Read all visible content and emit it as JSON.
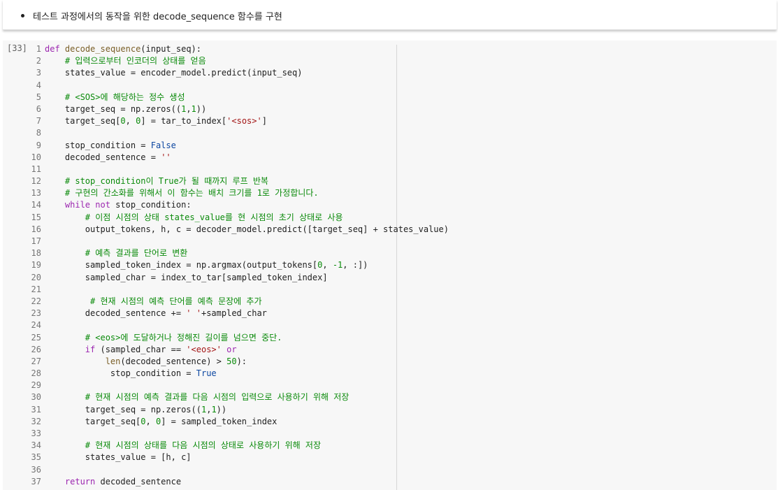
{
  "text_cell": {
    "bullet": "테스트 과정에서의 동작을 위한 decode_sequence 함수를 구현"
  },
  "code_cell": {
    "execution_count": "[33]",
    "lines": [
      {
        "n": "1",
        "indent": "",
        "tokens": [
          {
            "t": "def",
            "c": "kw"
          },
          {
            "t": " "
          },
          {
            "t": "decode_sequence",
            "c": "fn"
          },
          {
            "t": "(input_seq):"
          }
        ]
      },
      {
        "n": "2",
        "indent": "    ",
        "tokens": [
          {
            "t": "# 입력으로부터 인코더의 상태를 얻음",
            "c": "cm"
          }
        ]
      },
      {
        "n": "3",
        "indent": "    ",
        "tokens": [
          {
            "t": "states_value = encoder_model.predict(input_seq)"
          }
        ]
      },
      {
        "n": "4",
        "indent": "",
        "tokens": []
      },
      {
        "n": "5",
        "indent": "    ",
        "tokens": [
          {
            "t": "# <SOS>에 해당하는 정수 생성",
            "c": "cm"
          }
        ]
      },
      {
        "n": "6",
        "indent": "    ",
        "tokens": [
          {
            "t": "target_seq = np.zeros(("
          },
          {
            "t": "1",
            "c": "nm"
          },
          {
            "t": ","
          },
          {
            "t": "1",
            "c": "nm"
          },
          {
            "t": "))"
          }
        ]
      },
      {
        "n": "7",
        "indent": "    ",
        "tokens": [
          {
            "t": "target_seq["
          },
          {
            "t": "0",
            "c": "nm"
          },
          {
            "t": ", "
          },
          {
            "t": "0",
            "c": "nm"
          },
          {
            "t": "] = tar_to_index["
          },
          {
            "t": "'<sos>'",
            "c": "st"
          },
          {
            "t": "]"
          }
        ]
      },
      {
        "n": "8",
        "indent": "",
        "tokens": []
      },
      {
        "n": "9",
        "indent": "    ",
        "tokens": [
          {
            "t": "stop_condition = "
          },
          {
            "t": "False",
            "c": "kw2"
          }
        ]
      },
      {
        "n": "10",
        "indent": "    ",
        "tokens": [
          {
            "t": "decoded_sentence = "
          },
          {
            "t": "''",
            "c": "st"
          }
        ]
      },
      {
        "n": "11",
        "indent": "",
        "tokens": []
      },
      {
        "n": "12",
        "indent": "    ",
        "tokens": [
          {
            "t": "# stop_condition이 True가 될 때까지 루프 반복",
            "c": "cm"
          }
        ]
      },
      {
        "n": "13",
        "indent": "    ",
        "tokens": [
          {
            "t": "# 구현의 간소화를 위해서 이 함수는 배치 크기를 1로 가정합니다.",
            "c": "cm"
          }
        ]
      },
      {
        "n": "14",
        "indent": "    ",
        "tokens": [
          {
            "t": "while",
            "c": "kw"
          },
          {
            "t": " "
          },
          {
            "t": "not",
            "c": "kw"
          },
          {
            "t": " stop_condition:"
          }
        ]
      },
      {
        "n": "15",
        "indent": "        ",
        "tokens": [
          {
            "t": "# 이점 시점의 상태 states_value를 현 시점의 초기 상태로 사용",
            "c": "cm"
          }
        ]
      },
      {
        "n": "16",
        "indent": "        ",
        "tokens": [
          {
            "t": "output_tokens, h, c = decoder_model.predict([target_seq] + states_value)"
          }
        ]
      },
      {
        "n": "17",
        "indent": "",
        "tokens": []
      },
      {
        "n": "18",
        "indent": "        ",
        "tokens": [
          {
            "t": "# 예측 결과를 단어로 변환",
            "c": "cm"
          }
        ]
      },
      {
        "n": "19",
        "indent": "        ",
        "tokens": [
          {
            "t": "sampled_token_index = np.argmax(output_tokens["
          },
          {
            "t": "0",
            "c": "nm"
          },
          {
            "t": ", "
          },
          {
            "t": "-1",
            "c": "nm"
          },
          {
            "t": ", :])"
          }
        ]
      },
      {
        "n": "20",
        "indent": "        ",
        "tokens": [
          {
            "t": "sampled_char = index_to_tar[sampled_token_index]"
          }
        ]
      },
      {
        "n": "21",
        "indent": "",
        "tokens": []
      },
      {
        "n": "22",
        "indent": "         ",
        "tokens": [
          {
            "t": "# 현재 시점의 예측 단어를 예측 문장에 추가",
            "c": "cm"
          }
        ]
      },
      {
        "n": "23",
        "indent": "        ",
        "tokens": [
          {
            "t": "decoded_sentence += "
          },
          {
            "t": "' '",
            "c": "st"
          },
          {
            "t": "+sampled_char"
          }
        ]
      },
      {
        "n": "24",
        "indent": "",
        "tokens": []
      },
      {
        "n": "25",
        "indent": "        ",
        "tokens": [
          {
            "t": "# <eos>에 도달하거나 정해진 길이를 넘으면 중단.",
            "c": "cm"
          }
        ]
      },
      {
        "n": "26",
        "indent": "        ",
        "tokens": [
          {
            "t": "if",
            "c": "kw"
          },
          {
            "t": " (sampled_char == "
          },
          {
            "t": "'<eos>'",
            "c": "st"
          },
          {
            "t": " "
          },
          {
            "t": "or",
            "c": "kw"
          }
        ]
      },
      {
        "n": "27",
        "indent": "            ",
        "tokens": [
          {
            "t": "len",
            "c": "bi"
          },
          {
            "t": "(decoded_sentence) > "
          },
          {
            "t": "50",
            "c": "nm"
          },
          {
            "t": "):"
          }
        ]
      },
      {
        "n": "28",
        "indent": "             ",
        "tokens": [
          {
            "t": "stop_condition = "
          },
          {
            "t": "True",
            "c": "kw2"
          }
        ]
      },
      {
        "n": "29",
        "indent": "",
        "tokens": []
      },
      {
        "n": "30",
        "indent": "        ",
        "tokens": [
          {
            "t": "# 현재 시점의 예측 결과를 다음 시점의 입력으로 사용하기 위해 저장",
            "c": "cm"
          }
        ]
      },
      {
        "n": "31",
        "indent": "        ",
        "tokens": [
          {
            "t": "target_seq = np.zeros(("
          },
          {
            "t": "1",
            "c": "nm"
          },
          {
            "t": ","
          },
          {
            "t": "1",
            "c": "nm"
          },
          {
            "t": "))"
          }
        ]
      },
      {
        "n": "32",
        "indent": "        ",
        "tokens": [
          {
            "t": "target_seq["
          },
          {
            "t": "0",
            "c": "nm"
          },
          {
            "t": ", "
          },
          {
            "t": "0",
            "c": "nm"
          },
          {
            "t": "] = sampled_token_index"
          }
        ]
      },
      {
        "n": "33",
        "indent": "",
        "tokens": []
      },
      {
        "n": "34",
        "indent": "        ",
        "tokens": [
          {
            "t": "# 현재 시점의 상태를 다음 시점의 상태로 사용하기 위해 저장",
            "c": "cm"
          }
        ]
      },
      {
        "n": "35",
        "indent": "        ",
        "tokens": [
          {
            "t": "states_value = [h, c]"
          }
        ]
      },
      {
        "n": "36",
        "indent": "",
        "tokens": []
      },
      {
        "n": "37",
        "indent": "    ",
        "tokens": [
          {
            "t": "return",
            "c": "kw"
          },
          {
            "t": " decoded_sentence"
          }
        ]
      }
    ]
  },
  "colors": {
    "keyword": "#9c27b0",
    "constant": "#0d47a1",
    "comment": "#0a8a0a",
    "string": "#a31515",
    "number": "#0a8a0a",
    "function_name": "#795e26"
  }
}
